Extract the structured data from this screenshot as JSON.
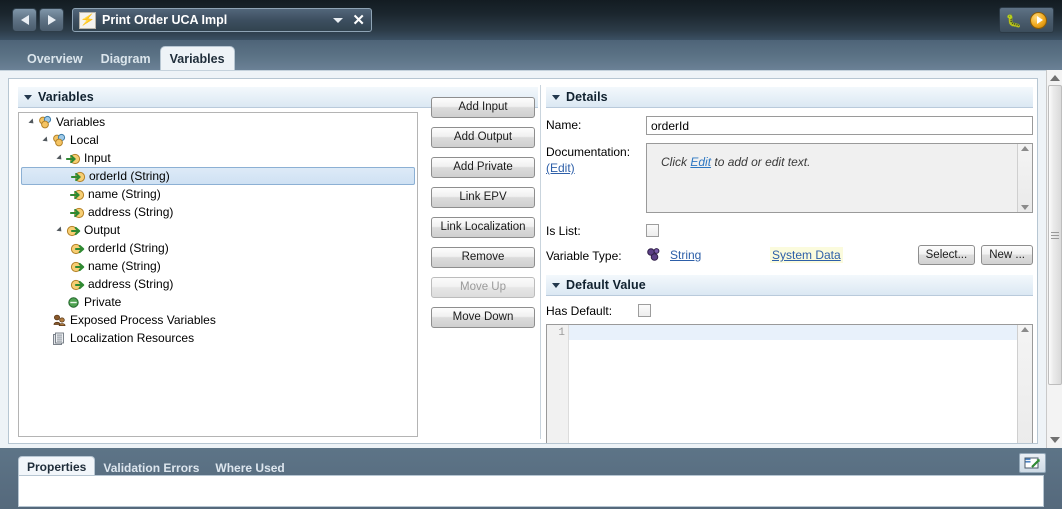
{
  "titlebar": {
    "editor_name": "Print Order UCA Impl",
    "editor_icon": "lightning-bolt-icon",
    "back_icon": "back-arrow-icon",
    "forward_icon": "forward-arrow-icon",
    "dropdown_icon": "chevron-down-icon",
    "close_label": "✕",
    "debug_icon": "bug-icon",
    "run_icon": "run-play-icon"
  },
  "editor_tabs": [
    {
      "label": "Overview",
      "active": false
    },
    {
      "label": "Diagram",
      "active": false
    },
    {
      "label": "Variables",
      "active": true
    }
  ],
  "variables_section": {
    "title": "Variables",
    "tree": [
      {
        "label": "Variables",
        "depth": 0,
        "icon": "variables-group-icon",
        "expandable": true,
        "selected": false
      },
      {
        "label": "Local",
        "depth": 1,
        "icon": "variables-group-icon",
        "expandable": true,
        "selected": false
      },
      {
        "label": "Input",
        "depth": 2,
        "icon": "input-variable-icon",
        "expandable": true,
        "selected": false
      },
      {
        "label": "orderId (String)",
        "depth": 3,
        "icon": "input-variable-icon",
        "expandable": false,
        "selected": true
      },
      {
        "label": "name (String)",
        "depth": 3,
        "icon": "input-variable-icon",
        "expandable": false,
        "selected": false
      },
      {
        "label": "address (String)",
        "depth": 3,
        "icon": "input-variable-icon",
        "expandable": false,
        "selected": false
      },
      {
        "label": "Output",
        "depth": 2,
        "icon": "output-variable-icon",
        "expandable": true,
        "selected": false
      },
      {
        "label": "orderId (String)",
        "depth": 3,
        "icon": "output-variable-icon",
        "expandable": false,
        "selected": false
      },
      {
        "label": "name (String)",
        "depth": 3,
        "icon": "output-variable-icon",
        "expandable": false,
        "selected": false
      },
      {
        "label": "address (String)",
        "depth": 3,
        "icon": "output-variable-icon",
        "expandable": false,
        "selected": false
      },
      {
        "label": "Private",
        "depth": 2,
        "icon": "private-variable-icon",
        "expandable": false,
        "selected": false
      },
      {
        "label": "Exposed Process Variables",
        "depth": 1,
        "icon": "exposed-process-variables-icon",
        "expandable": false,
        "selected": false
      },
      {
        "label": "Localization Resources",
        "depth": 1,
        "icon": "localization-resources-icon",
        "expandable": false,
        "selected": false
      }
    ],
    "buttons": [
      {
        "label": "Add Input",
        "disabled": false
      },
      {
        "label": "Add Output",
        "disabled": false
      },
      {
        "label": "Add Private",
        "disabled": false
      },
      {
        "label": "Link EPV",
        "disabled": false
      },
      {
        "label": "Link Localization",
        "disabled": false
      },
      {
        "label": "Remove",
        "disabled": false
      },
      {
        "label": "Move Up",
        "disabled": true
      },
      {
        "label": "Move Down",
        "disabled": false
      }
    ]
  },
  "details_section": {
    "title": "Details",
    "name_label": "Name:",
    "name_value": "orderId",
    "documentation_label": "Documentation:",
    "documentation_edit_link": "(Edit)",
    "documentation_placeholder_prefix": "Click ",
    "documentation_placeholder_link": "Edit",
    "documentation_placeholder_suffix": " to add or edit text.",
    "is_list_label": "Is List:",
    "is_list_checked": false,
    "variable_type_label": "Variable Type:",
    "variable_type_value": "String",
    "variable_type_icon": "data-type-icon",
    "system_data_label": "System Data",
    "select_button": "Select...",
    "new_button": "New ..."
  },
  "default_value_section": {
    "title": "Default Value",
    "has_default_label": "Has Default:",
    "has_default_checked": false,
    "first_line_number": "1",
    "code_value": ""
  },
  "bottom_view": {
    "tabs": [
      {
        "label": "Properties",
        "active": true
      },
      {
        "label": "Validation Errors",
        "active": false
      },
      {
        "label": "Where Used",
        "active": false
      }
    ],
    "restore_icon": "restore-view-icon"
  },
  "colors": {
    "chrome": "#6b8196",
    "titlebar_dark": "#1b262e",
    "selection": "#cfe1f3",
    "link": "#2d5fa8",
    "highlight": "#fbfbdd",
    "accent_orange": "#f0a81c"
  }
}
